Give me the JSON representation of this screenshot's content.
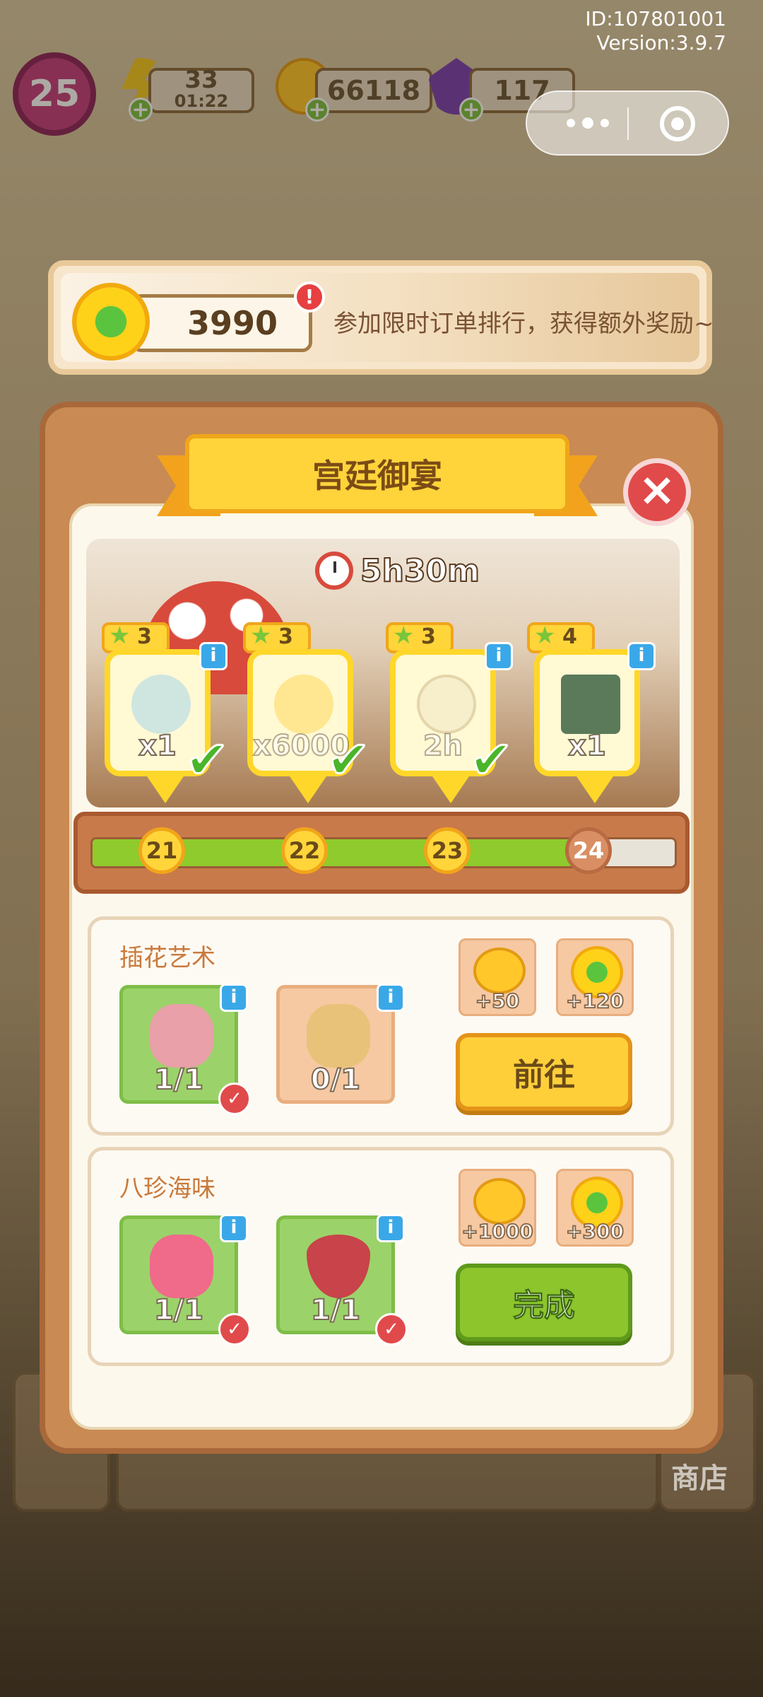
{
  "meta": {
    "id": "ID:107801001",
    "version": "Version:3.9.7"
  },
  "hud": {
    "level": "25",
    "energy": {
      "value": "33",
      "timer": "01:22",
      "icon": "lightning-icon"
    },
    "coins": {
      "value": "66118",
      "icon": "coin-icon"
    },
    "gems": {
      "value": "117",
      "icon": "gem-icon"
    }
  },
  "banner": {
    "score": "3990",
    "alert": "!",
    "text": "参加限时订单排行，获得额外奖励~"
  },
  "panel": {
    "title": "宫廷御宴",
    "close": "×",
    "timer": "5h30m",
    "rewards": [
      {
        "stars": "3",
        "qty": "x1",
        "claimed": true,
        "icon": "fountain-icon"
      },
      {
        "stars": "3",
        "qty": "x6000",
        "claimed": true,
        "icon": "coin-icon"
      },
      {
        "stars": "3",
        "qty": "2h",
        "claimed": true,
        "icon": "stopwatch-icon"
      },
      {
        "stars": "4",
        "qty": "x1",
        "claimed": false,
        "icon": "pavilion-icon"
      }
    ],
    "milestones": [
      "21",
      "22",
      "23",
      "24"
    ],
    "progress": 0.88
  },
  "tasks": [
    {
      "title": "插花艺术",
      "items": [
        {
          "progress": "1/1",
          "done": true,
          "icon": "bottle-icon"
        },
        {
          "progress": "0/1",
          "done": false,
          "icon": "flower-crate-icon"
        }
      ],
      "rewards": [
        {
          "value": "+50",
          "icon": "coin-icon"
        },
        {
          "value": "+120",
          "icon": "flower-gem-icon"
        }
      ],
      "button": "前往"
    },
    {
      "title": "八珍海味",
      "items": [
        {
          "progress": "1/1",
          "done": true,
          "icon": "bouquet-icon"
        },
        {
          "progress": "1/1",
          "done": true,
          "icon": "soup-bowl-icon"
        }
      ],
      "rewards": [
        {
          "value": "+1000",
          "icon": "coin-icon"
        },
        {
          "value": "+300",
          "icon": "flower-gem-icon"
        }
      ],
      "button": "完成"
    }
  ],
  "bottom": {
    "shop": "商店"
  },
  "colors": {
    "accent_yellow": "#ffd43a",
    "progress_green": "#8fcb2c",
    "close_red": "#e14a4a"
  }
}
